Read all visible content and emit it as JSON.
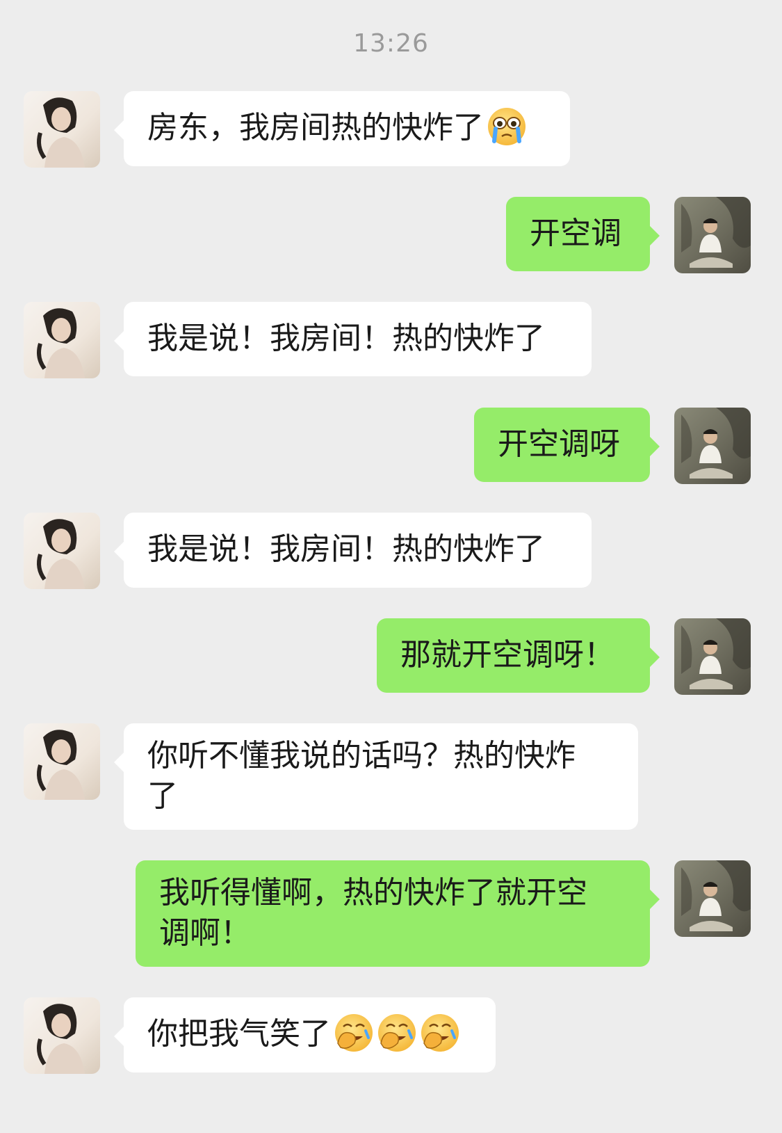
{
  "chat": {
    "timestamp": "13:26",
    "messages": [
      {
        "side": "in",
        "text": "房东，我房间热的快炸了",
        "emoji": [
          "crying-face-icon"
        ]
      },
      {
        "side": "out",
        "text": "开空调"
      },
      {
        "side": "in",
        "text": "我是说！我房间！热的快炸了"
      },
      {
        "side": "out",
        "text": "开空调呀"
      },
      {
        "side": "in",
        "text": "我是说！我房间！热的快炸了"
      },
      {
        "side": "out",
        "text": "那就开空调呀！"
      },
      {
        "side": "in",
        "text_line1": "你听不懂我说的话吗？热的快炸",
        "text_line2": "了"
      },
      {
        "side": "out",
        "text_line1": "我听得懂啊，热的快炸了就开空",
        "text_line2": "调啊！"
      },
      {
        "side": "in",
        "text": "你把我气笑了",
        "emoji": [
          "facepalm-laugh-icon",
          "facepalm-laugh-icon",
          "facepalm-laugh-icon"
        ]
      }
    ]
  },
  "colors": {
    "background": "#ededed",
    "incoming_bubble": "#ffffff",
    "outgoing_bubble": "#95ec69",
    "timestamp_text": "#9a9a9a"
  }
}
